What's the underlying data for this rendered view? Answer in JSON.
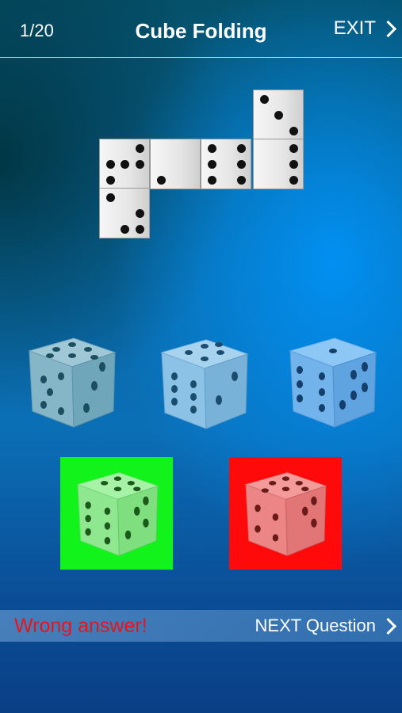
{
  "header": {
    "counter": "1/20",
    "title": "Cube Folding",
    "exit_label": "EXIT"
  },
  "net": {
    "faces": [
      {
        "name": "face-top-3",
        "pips": 3
      },
      {
        "name": "face-left-5",
        "pips": 5
      },
      {
        "name": "face-1",
        "pips": 1
      },
      {
        "name": "face-6",
        "pips": 6
      },
      {
        "name": "face-4",
        "pips": 4
      },
      {
        "name": "face-bottom-3",
        "pips": 3
      }
    ]
  },
  "options": {
    "row1": [
      "option-die-1",
      "option-die-2",
      "option-die-3"
    ],
    "row2": [
      {
        "name": "option-die-4",
        "status": "correct",
        "color": "#12f21b"
      },
      {
        "name": "option-die-5",
        "status": "wrong",
        "color": "#ff0a0a"
      }
    ]
  },
  "result": {
    "message": "Wrong answer!",
    "next_label": "NEXT Question",
    "message_color": "#e8141c"
  }
}
